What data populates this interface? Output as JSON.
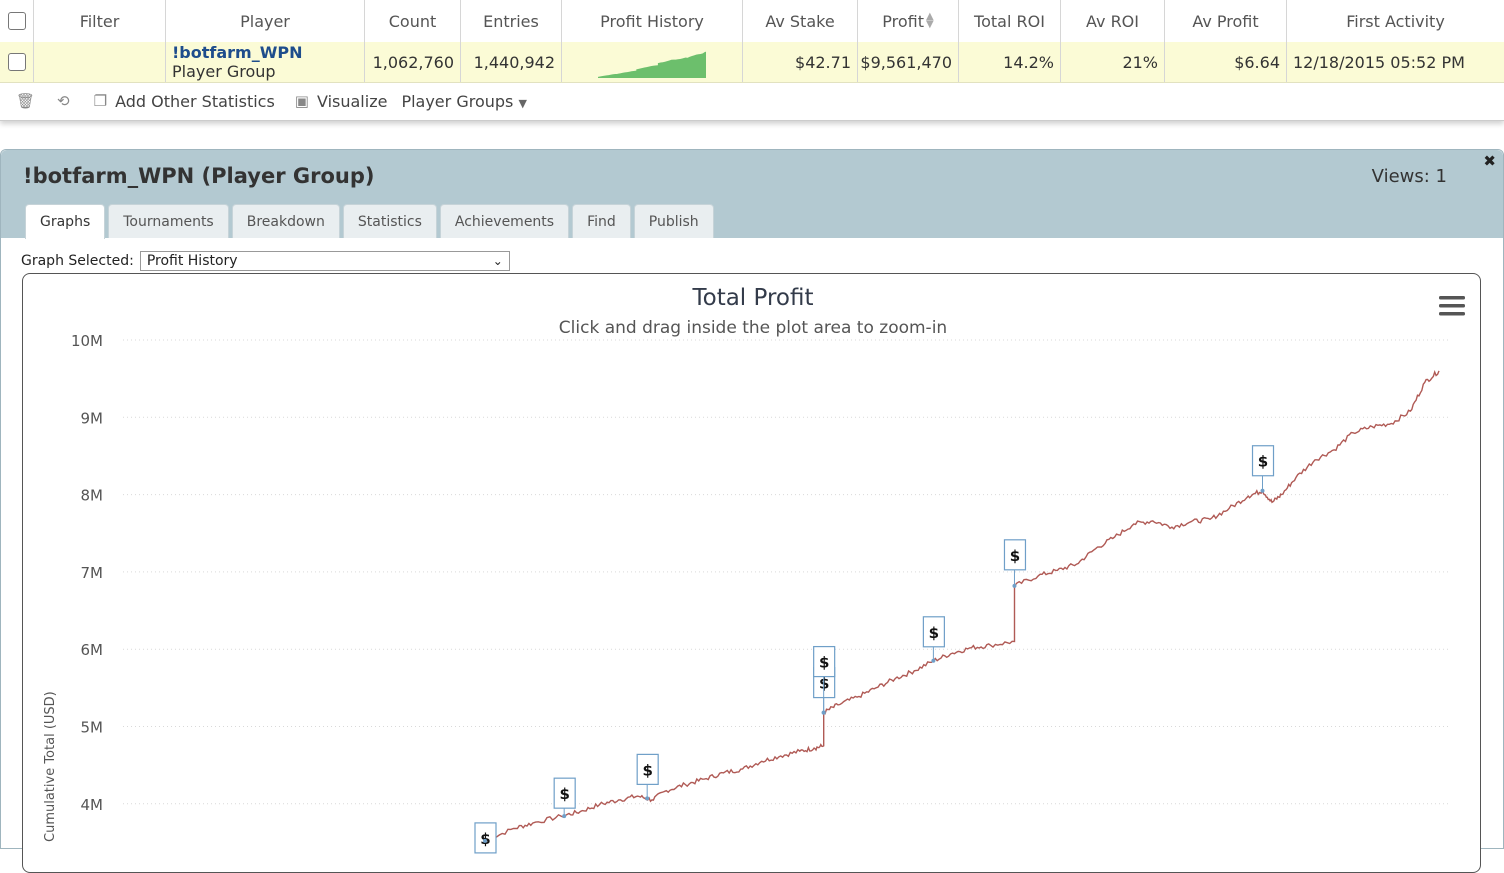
{
  "table": {
    "headers": [
      "Filter",
      "Player",
      "Count",
      "Entries",
      "Profit History",
      "Av Stake",
      "Profit",
      "Total ROI",
      "Av ROI",
      "Av Profit",
      "First Activity"
    ],
    "row": {
      "player_name": "!botfarm_WPN",
      "player_type": "Player Group",
      "count": "1,062,760",
      "entries": "1,440,942",
      "av_stake": "$42.71",
      "profit": "$9,561,470",
      "total_roi": "14.2%",
      "av_roi": "21%",
      "av_profit": "$6.64",
      "first_activity": "12/18/2015 05:52 PM"
    },
    "sparkline_color": "#6cbf6c",
    "toolbar": {
      "add_stats": "Add Other Statistics",
      "visualize": "Visualize",
      "player_groups": "Player Groups"
    },
    "icons": [
      "trash-icon",
      "refresh-icon",
      "window-icon",
      "image-icon",
      "caret-down-icon"
    ]
  },
  "panel": {
    "title": "!botfarm_WPN (Player Group)",
    "views": "Views: 1",
    "tabs": [
      "Graphs",
      "Tournaments",
      "Breakdown",
      "Statistics",
      "Achievements",
      "Find",
      "Publish"
    ],
    "active_tab": "Graphs",
    "graph_label": "Graph Selected:",
    "graph_selected": "Profit History",
    "header_color": "#b3c9d1"
  },
  "chart_data": {
    "type": "line",
    "title": "Total Profit",
    "subtitle": "Click and drag inside the plot area to zoom-in",
    "ylabel": "Cumulative Total (USD)",
    "y_ticks": [
      "4M",
      "5M",
      "6M",
      "7M",
      "8M",
      "9M",
      "10M"
    ],
    "ylim": [
      3500000,
      10000000
    ],
    "line_color": "#b05a55",
    "series": [
      {
        "points": [
          [
            0.0,
            3.52
          ],
          [
            0.03,
            3.68
          ],
          [
            0.05,
            3.75
          ],
          [
            0.08,
            3.84
          ],
          [
            0.1,
            3.9
          ],
          [
            0.12,
            3.99
          ],
          [
            0.14,
            4.05
          ],
          [
            0.16,
            4.1
          ],
          [
            0.175,
            4.05
          ],
          [
            0.19,
            4.17
          ],
          [
            0.21,
            4.25
          ],
          [
            0.23,
            4.32
          ],
          [
            0.25,
            4.4
          ],
          [
            0.27,
            4.45
          ],
          [
            0.29,
            4.55
          ],
          [
            0.31,
            4.62
          ],
          [
            0.33,
            4.68
          ],
          [
            0.345,
            4.72
          ],
          [
            0.355,
            4.75
          ],
          [
            0.355,
            5.18
          ],
          [
            0.37,
            5.28
          ],
          [
            0.39,
            5.38
          ],
          [
            0.41,
            5.5
          ],
          [
            0.43,
            5.62
          ],
          [
            0.45,
            5.72
          ],
          [
            0.47,
            5.85
          ],
          [
            0.49,
            5.95
          ],
          [
            0.51,
            6.02
          ],
          [
            0.53,
            6.05
          ],
          [
            0.555,
            6.1
          ],
          [
            0.555,
            6.82
          ],
          [
            0.58,
            6.95
          ],
          [
            0.6,
            7.02
          ],
          [
            0.62,
            7.1
          ],
          [
            0.64,
            7.3
          ],
          [
            0.66,
            7.45
          ],
          [
            0.68,
            7.62
          ],
          [
            0.7,
            7.66
          ],
          [
            0.72,
            7.58
          ],
          [
            0.74,
            7.65
          ],
          [
            0.76,
            7.68
          ],
          [
            0.78,
            7.82
          ],
          [
            0.8,
            7.98
          ],
          [
            0.815,
            8.05
          ],
          [
            0.825,
            7.9
          ],
          [
            0.835,
            8.0
          ],
          [
            0.85,
            8.22
          ],
          [
            0.87,
            8.45
          ],
          [
            0.89,
            8.58
          ],
          [
            0.91,
            8.8
          ],
          [
            0.93,
            8.88
          ],
          [
            0.95,
            8.92
          ],
          [
            0.97,
            9.08
          ],
          [
            0.985,
            9.45
          ],
          [
            1.0,
            9.6
          ]
        ]
      }
    ],
    "markers": [
      {
        "at": 0.0,
        "y": 3.52,
        "label": "$"
      },
      {
        "at": 0.083,
        "y": 3.84,
        "label": "$"
      },
      {
        "at": 0.17,
        "y": 4.07,
        "label": "$"
      },
      {
        "at": 0.355,
        "y": 5.18,
        "label": "$"
      },
      {
        "at": 0.355,
        "y": 5.18,
        "label": "$"
      },
      {
        "at": 0.47,
        "y": 5.85,
        "label": "$"
      },
      {
        "at": 0.555,
        "y": 6.82,
        "label": "$"
      },
      {
        "at": 0.815,
        "y": 8.05,
        "label": "$"
      }
    ]
  }
}
